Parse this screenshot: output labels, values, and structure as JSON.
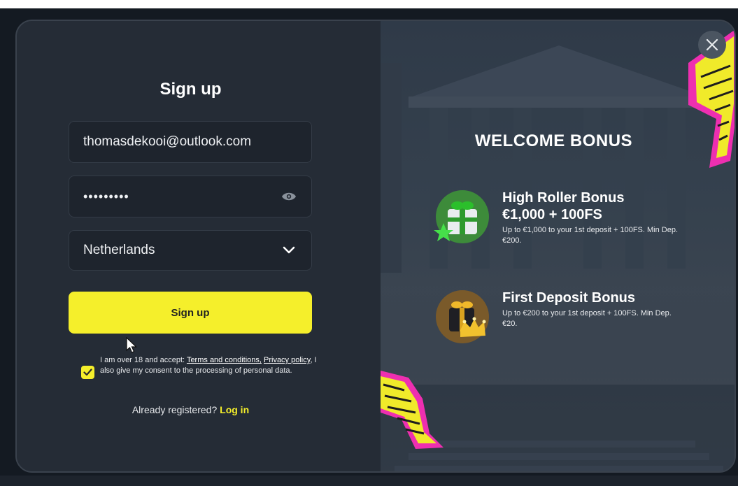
{
  "signup": {
    "title": "Sign up",
    "email_value": "thomasdekooi@outlook.com",
    "password_mask": "•••••••••",
    "country_value": "Netherlands",
    "submit_label": "Sign up",
    "consent": {
      "checked": true,
      "text_before": "I am over 18 and accept: ",
      "terms_link": "Terms and conditions,",
      "privacy_link": "Privacy policy",
      "text_after": ", I also give my consent to the processing of personal data."
    },
    "login_prompt": "Already registered?",
    "login_link": "Log in"
  },
  "promo": {
    "heading": "WELCOME BONUS",
    "bonuses": [
      {
        "title": "High Roller Bonus",
        "amount": "€1,000 + 100FS",
        "description": "Up to €1,000 to your 1st deposit + 100FS. Min Dep. €200.",
        "icon": "gift-box-icon"
      },
      {
        "title": "First Deposit Bonus",
        "amount": "",
        "description": "Up to €200 to your 1st deposit + 100FS. Min Dep. €20.",
        "icon": "crown-gift-icon"
      }
    ]
  },
  "colors": {
    "accent": "#f5ef2b",
    "lightning_pink": "#ee2fb0",
    "panel_bg": "#252c36"
  },
  "icons": [
    "eye-icon",
    "chevron-down-icon",
    "checkmark-icon",
    "close-icon",
    "cursor-icon"
  ]
}
